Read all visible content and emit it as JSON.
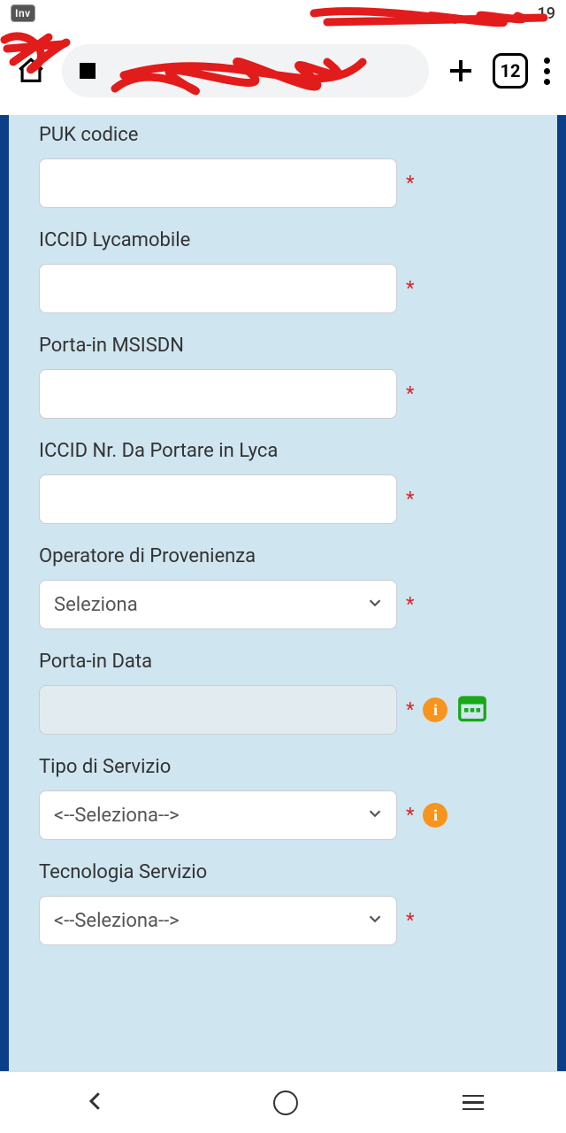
{
  "status": {
    "inv_badge": "Inv",
    "time": "19"
  },
  "browser": {
    "url": "",
    "tab_count": "12"
  },
  "form": {
    "puk": {
      "label": "PUK codice",
      "value": ""
    },
    "iccid_lyca": {
      "label": "ICCID Lycamobile",
      "value": ""
    },
    "msisdn": {
      "label": "Porta-in MSISDN",
      "value": ""
    },
    "iccid_port": {
      "label": "ICCID Nr. Da Portare in Lyca",
      "value": ""
    },
    "operator": {
      "label": "Operatore di Provenienza",
      "selected": "Seleziona"
    },
    "date": {
      "label": "Porta-in Data",
      "value": ""
    },
    "service_type": {
      "label": "Tipo di Servizio",
      "selected": "<--Seleziona-->"
    },
    "tech": {
      "label": "Tecnologia Servizio",
      "selected": "<--Seleziona-->"
    }
  },
  "required_marker": "*"
}
